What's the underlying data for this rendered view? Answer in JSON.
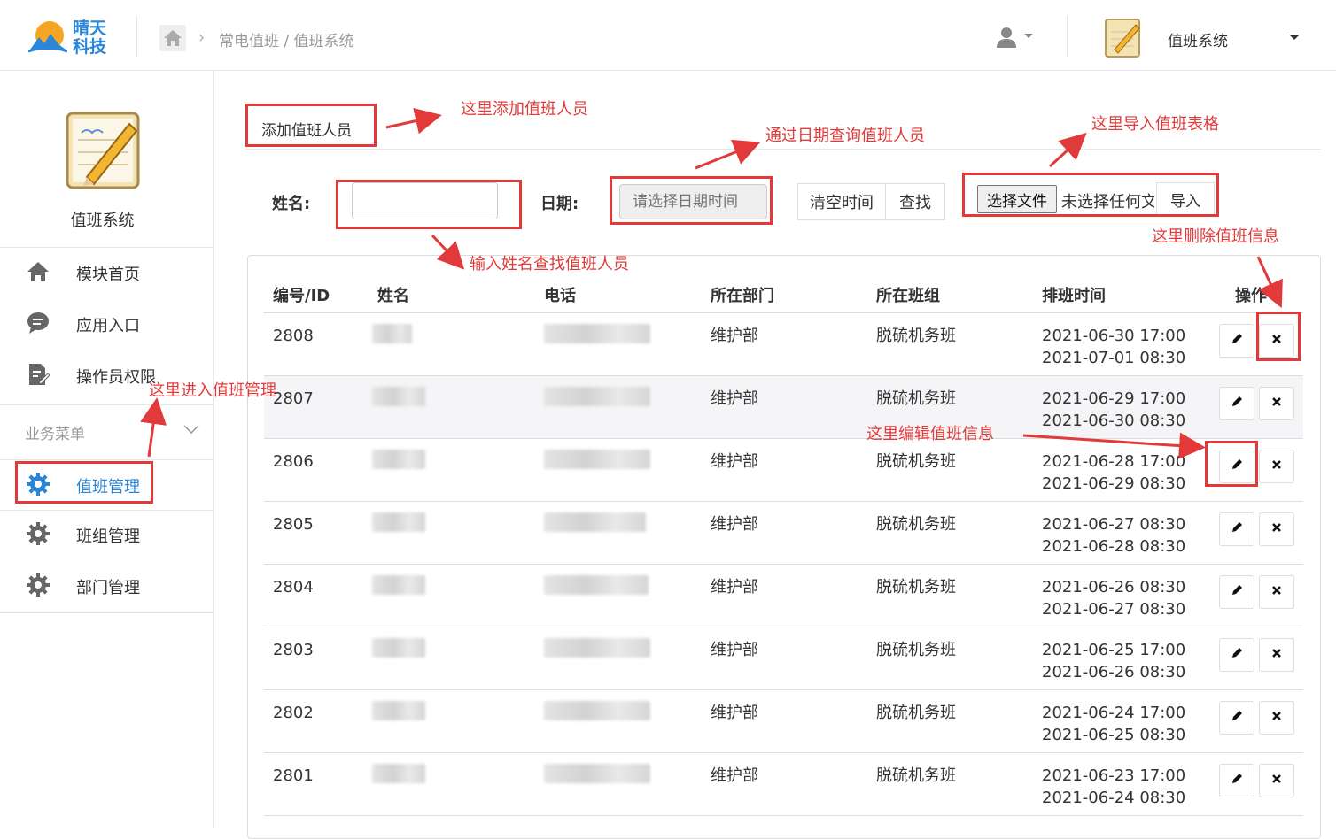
{
  "header": {
    "brand_line1": "晴天",
    "brand_line2": "科技",
    "breadcrumb": "常电值班 / 值班系统",
    "app_title": "值班系统"
  },
  "sidebar": {
    "title": "值班系统",
    "items": [
      {
        "label": "模块首页",
        "icon": "home-icon"
      },
      {
        "label": "应用入口",
        "icon": "chat-icon"
      },
      {
        "label": "操作员权限",
        "icon": "document-edit-icon"
      }
    ],
    "group": "业务菜单",
    "group_items": [
      {
        "label": "值班管理",
        "icon": "gear-icon",
        "active": true
      },
      {
        "label": "班组管理",
        "icon": "gear-icon"
      },
      {
        "label": "部门管理",
        "icon": "gear-icon"
      }
    ]
  },
  "toolbar": {
    "add_label": "添加值班人员",
    "name_label": "姓名:",
    "name_value": "",
    "date_label": "日期:",
    "date_placeholder": "请选择日期时间",
    "clear_label": "清空时间",
    "search_label": "查找",
    "file_choose_label": "选择文件",
    "file_status": "未选择任何文件",
    "import_label": "导入"
  },
  "table": {
    "columns": [
      "编号/ID",
      "姓名",
      "电话",
      "所在部门",
      "所在班组",
      "排班时间",
      "操作"
    ],
    "rows": [
      {
        "id": "2808",
        "dept": "维护部",
        "team": "脱硫机务班",
        "start": "2021-06-30 17:00",
        "end": "2021-07-01 08:30"
      },
      {
        "id": "2807",
        "dept": "维护部",
        "team": "脱硫机务班",
        "start": "2021-06-29 17:00",
        "end": "2021-06-30 08:30"
      },
      {
        "id": "2806",
        "dept": "维护部",
        "team": "脱硫机务班",
        "start": "2021-06-28 17:00",
        "end": "2021-06-29 08:30"
      },
      {
        "id": "2805",
        "dept": "维护部",
        "team": "脱硫机务班",
        "start": "2021-06-27 08:30",
        "end": "2021-06-28 08:30"
      },
      {
        "id": "2804",
        "dept": "维护部",
        "team": "脱硫机务班",
        "start": "2021-06-26 08:30",
        "end": "2021-06-27 08:30"
      },
      {
        "id": "2803",
        "dept": "维护部",
        "team": "脱硫机务班",
        "start": "2021-06-25 17:00",
        "end": "2021-06-26 08:30"
      },
      {
        "id": "2802",
        "dept": "维护部",
        "team": "脱硫机务班",
        "start": "2021-06-24 17:00",
        "end": "2021-06-25 08:30"
      },
      {
        "id": "2801",
        "dept": "维护部",
        "team": "脱硫机务班",
        "start": "2021-06-23 17:00",
        "end": "2021-06-24 08:30"
      }
    ]
  },
  "annotations": {
    "add": "这里添加值班人员",
    "date": "通过日期查询值班人员",
    "import": "这里导入值班表格",
    "delete": "这里删除值班信息",
    "name": "输入姓名查找值班人员",
    "nav": "这里进入值班管理",
    "edit": "这里编辑值班信息"
  },
  "colors": {
    "accent": "#2a86d8",
    "annotation": "#e23a3a"
  }
}
